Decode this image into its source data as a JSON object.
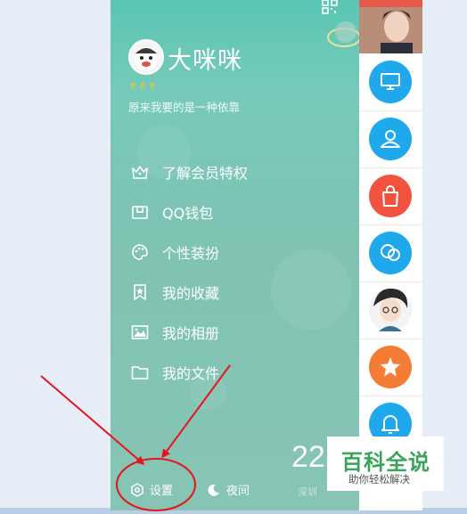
{
  "profile": {
    "nickname": "大咪咪",
    "signature": "原来我要的是一种依靠",
    "level_badges": [
      "☀",
      "☀",
      "☀"
    ]
  },
  "menu": [
    {
      "icon": "crown-icon",
      "label": "了解会员特权"
    },
    {
      "icon": "wallet-icon",
      "label": "QQ钱包"
    },
    {
      "icon": "palette-icon",
      "label": "个性装扮"
    },
    {
      "icon": "bookmark-star-icon",
      "label": "我的收藏"
    },
    {
      "icon": "photo-album-icon",
      "label": "我的相册"
    },
    {
      "icon": "folder-icon",
      "label": "我的文件"
    }
  ],
  "weather": {
    "value": "22",
    "sub": "深圳"
  },
  "footer": {
    "settings_label": "设置",
    "night_label": "夜间"
  },
  "right_strip": [
    "photo-avatar",
    "desktop-icon",
    "contacts-icon",
    "shopping-bag-icon",
    "chat-bubbles-icon",
    "cartoon-avatar",
    "star-icon",
    "bell-icon"
  ],
  "watermark": {
    "title": "百科全说",
    "subtitle": "助你轻松解决"
  },
  "colors": {
    "drawer_top": "#5bc6b4",
    "drawer_bottom": "#87c4b4",
    "accent_blue": "#1fa9ec",
    "accent_red": "#f2533e",
    "accent_orange": "#f47c34",
    "annotation_red": "#e8141b",
    "watermark_green": "#3aa55a"
  }
}
